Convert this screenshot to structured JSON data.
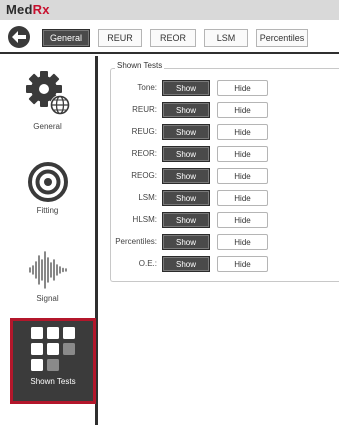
{
  "app": {
    "logo_text": "MedRx"
  },
  "toolbar": {
    "tabs": [
      {
        "label": "General",
        "active": true
      },
      {
        "label": "REUR"
      },
      {
        "label": "REOR"
      },
      {
        "label": "LSM"
      },
      {
        "label": "Percentiles"
      }
    ]
  },
  "sidebar": {
    "items": [
      {
        "label": "General",
        "icon": "gear-globe-icon"
      },
      {
        "label": "Fitting",
        "icon": "target-icon"
      },
      {
        "label": "Signal",
        "icon": "waveform-icon"
      },
      {
        "label": "Shown Tests",
        "icon": "grid-icon",
        "selected": true
      }
    ]
  },
  "shown_tests": {
    "title": "Shown Tests",
    "show_label": "Show",
    "hide_label": "Hide",
    "rows": [
      {
        "label": "Tone:",
        "state": "Show"
      },
      {
        "label": "REUR:",
        "state": "Show"
      },
      {
        "label": "REUG:",
        "state": "Show"
      },
      {
        "label": "REOR:",
        "state": "Show"
      },
      {
        "label": "REOG:",
        "state": "Show"
      },
      {
        "label": "LSM:",
        "state": "Show"
      },
      {
        "label": "HLSM:",
        "state": "Show"
      },
      {
        "label": "Percentiles:",
        "state": "Show"
      },
      {
        "label": "O.E.:",
        "state": "Show"
      }
    ]
  },
  "colors": {
    "accent_red": "#b3172b",
    "dark_button": "#4a4a4a"
  }
}
